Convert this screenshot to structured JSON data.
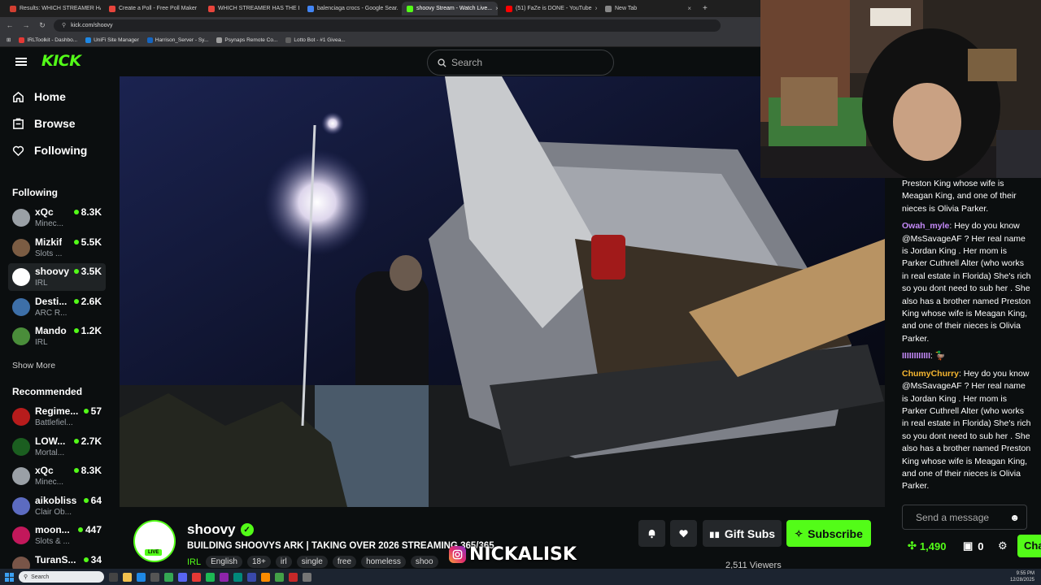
{
  "browser": {
    "tabs": [
      {
        "label": "Results: WHICH STREAMER HA...",
        "color": "#d23f31",
        "active": false
      },
      {
        "label": "Create a Poll - Free Poll Maker",
        "color": "#e8453c",
        "active": false
      },
      {
        "label": "WHICH STREAMER HAS THE B...",
        "color": "#e8453c",
        "active": false
      },
      {
        "label": "balenciaga crocs - Google Sear...",
        "color": "#4285f4",
        "active": false
      },
      {
        "label": "shoovy Stream - Watch Live...",
        "color": "#53fc18",
        "active": true
      },
      {
        "label": "(51) FaZe is DONE - YouTube",
        "color": "#ff0000",
        "active": false
      },
      {
        "label": "New Tab",
        "color": "#888888",
        "active": false
      }
    ],
    "url": "kick.com/shoovy",
    "bookmarks": [
      {
        "label": "IRLToolkit - Dashbo...",
        "color": "#e53935"
      },
      {
        "label": "UniFi Site Manager",
        "color": "#1e88e5"
      },
      {
        "label": "Harrison_Server - Sy...",
        "color": "#1565c0"
      },
      {
        "label": "Psynaps Remote Co...",
        "color": "#9e9e9e"
      },
      {
        "label": "Lotto Bot - #1 Givea...",
        "color": "#616161"
      }
    ]
  },
  "header": {
    "logo": "KICK",
    "search_placeholder": "Search"
  },
  "sidebar": {
    "nav": [
      {
        "label": "Home",
        "icon": "home-icon"
      },
      {
        "label": "Browse",
        "icon": "browse-icon"
      },
      {
        "label": "Following",
        "icon": "heart-icon"
      }
    ],
    "following_title": "Following",
    "following": [
      {
        "name": "xQc",
        "viewers": "8.3K",
        "category": "Minec...",
        "color": "#9aa0a6"
      },
      {
        "name": "Mizkif",
        "viewers": "5.5K",
        "category": "Slots ...",
        "color": "#7b5c43"
      },
      {
        "name": "shoovy",
        "viewers": "3.5K",
        "category": "IRL",
        "color": "#ffffff"
      },
      {
        "name": "Desti...",
        "viewers": "2.6K",
        "category": "ARC R...",
        "color": "#3d6fa8"
      },
      {
        "name": "Mando",
        "viewers": "1.2K",
        "category": "IRL",
        "color": "#4a8d3a"
      }
    ],
    "show_more": "Show More",
    "recommended_title": "Recommended",
    "recommended": [
      {
        "name": "Regime...",
        "viewers": "57",
        "category": "Battlefiel...",
        "color": "#b71c1c"
      },
      {
        "name": "LOW...",
        "viewers": "2.7K",
        "category": "Mortal...",
        "color": "#1b5e20"
      },
      {
        "name": "xQc",
        "viewers": "8.3K",
        "category": "Minec...",
        "color": "#9aa0a6"
      },
      {
        "name": "aikobliss",
        "viewers": "64",
        "category": "Clair Ob...",
        "color": "#5c6bc0"
      },
      {
        "name": "moon...",
        "viewers": "447",
        "category": "Slots & ...",
        "color": "#c2185b"
      },
      {
        "name": "TuranS...",
        "viewers": "34",
        "category": "",
        "color": "#795548"
      }
    ]
  },
  "chat": {
    "messages": [
      {
        "user": "",
        "user_color": "#ffffff",
        "text": "Preston King whose wife is Meagan King, and one of their nieces is Olivia Parker."
      },
      {
        "user": "Owah_myle",
        "user_color": "#c58af9",
        "text": "Hey do you know @MsSavageAF ? Her real name is Jordan King . Her mom is Parker Cuthrell Alter (who works in real estate in Florida) She's rich so you dont need to sub her . She also has a brother named Preston King whose wife is Meagan King, and one of their nieces is Olivia Parker."
      },
      {
        "user": "IIIIIIIIIIII",
        "user_color": "#c58af9",
        "text": "🦆"
      },
      {
        "user": "ChumyChurry",
        "user_color": "#f7b731",
        "text": "Hey do you know @MsSavageAF ? Her real name is Jordan King . Her mom is Parker Cuthrell Alter (who works in real estate in Florida) She's rich so you dont need to sub her . She also has a brother named Preston King whose wife is Meagan King, and one of their nieces is Olivia Parker."
      }
    ],
    "input_placeholder": "Send a message",
    "kicks": "1,490",
    "gifts": "0",
    "chat_button": "Cha"
  },
  "stream": {
    "name": "shoovy",
    "live_badge": "LIVE",
    "title": "BUILDING SHOOVYS ARK | TAKING OVER 2026 STREAMING 365/365",
    "category": "IRL",
    "tags": [
      "English",
      "18+",
      "irl",
      "single",
      "free",
      "homeless",
      "shoo"
    ],
    "gift_label": "Gift Subs",
    "subscribe_label": "Subscribe",
    "viewers": "2,511 Viewers"
  },
  "watermark": "NICKALISK",
  "taskbar": {
    "search_placeholder": "Search",
    "time": "9:55 PM",
    "date": "12/28/2025"
  }
}
